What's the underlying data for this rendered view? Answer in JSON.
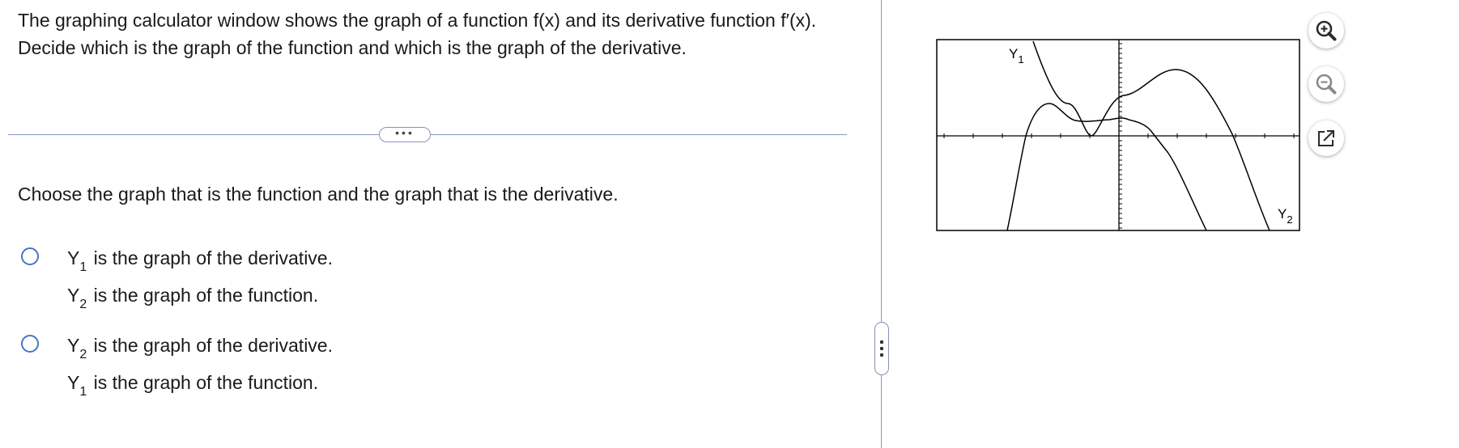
{
  "question": {
    "text": "The graphing calculator window shows the graph of a function f(x) and its derivative function f′(x).  Decide which is the graph of the function and which is the graph of the derivative."
  },
  "expand_label": "•••",
  "prompt": "Choose the graph that is the function and the graph that is the derivative.",
  "options": [
    {
      "line1": {
        "letter": "Y",
        "sub": "1",
        "rest": " is the graph of the derivative."
      },
      "line2": {
        "letter": "Y",
        "sub": "2",
        "rest": " is the graph of the function."
      },
      "selected": false
    },
    {
      "line1": {
        "letter": "Y",
        "sub": "2",
        "rest": " is the graph of the derivative."
      },
      "line2": {
        "letter": "Y",
        "sub": "1",
        "rest": " is the graph of the function."
      },
      "selected": false
    }
  ],
  "graph": {
    "label_y1": "Y",
    "label_y1_sub": "1",
    "label_y2": "Y",
    "label_y2_sub": "2"
  },
  "tools": {
    "zoom_in": "zoom-in-icon",
    "zoom_out": "zoom-out-icon",
    "popout": "popout-icon"
  },
  "colors": {
    "accent": "#4a74c9",
    "divider": "#8c97c2"
  }
}
